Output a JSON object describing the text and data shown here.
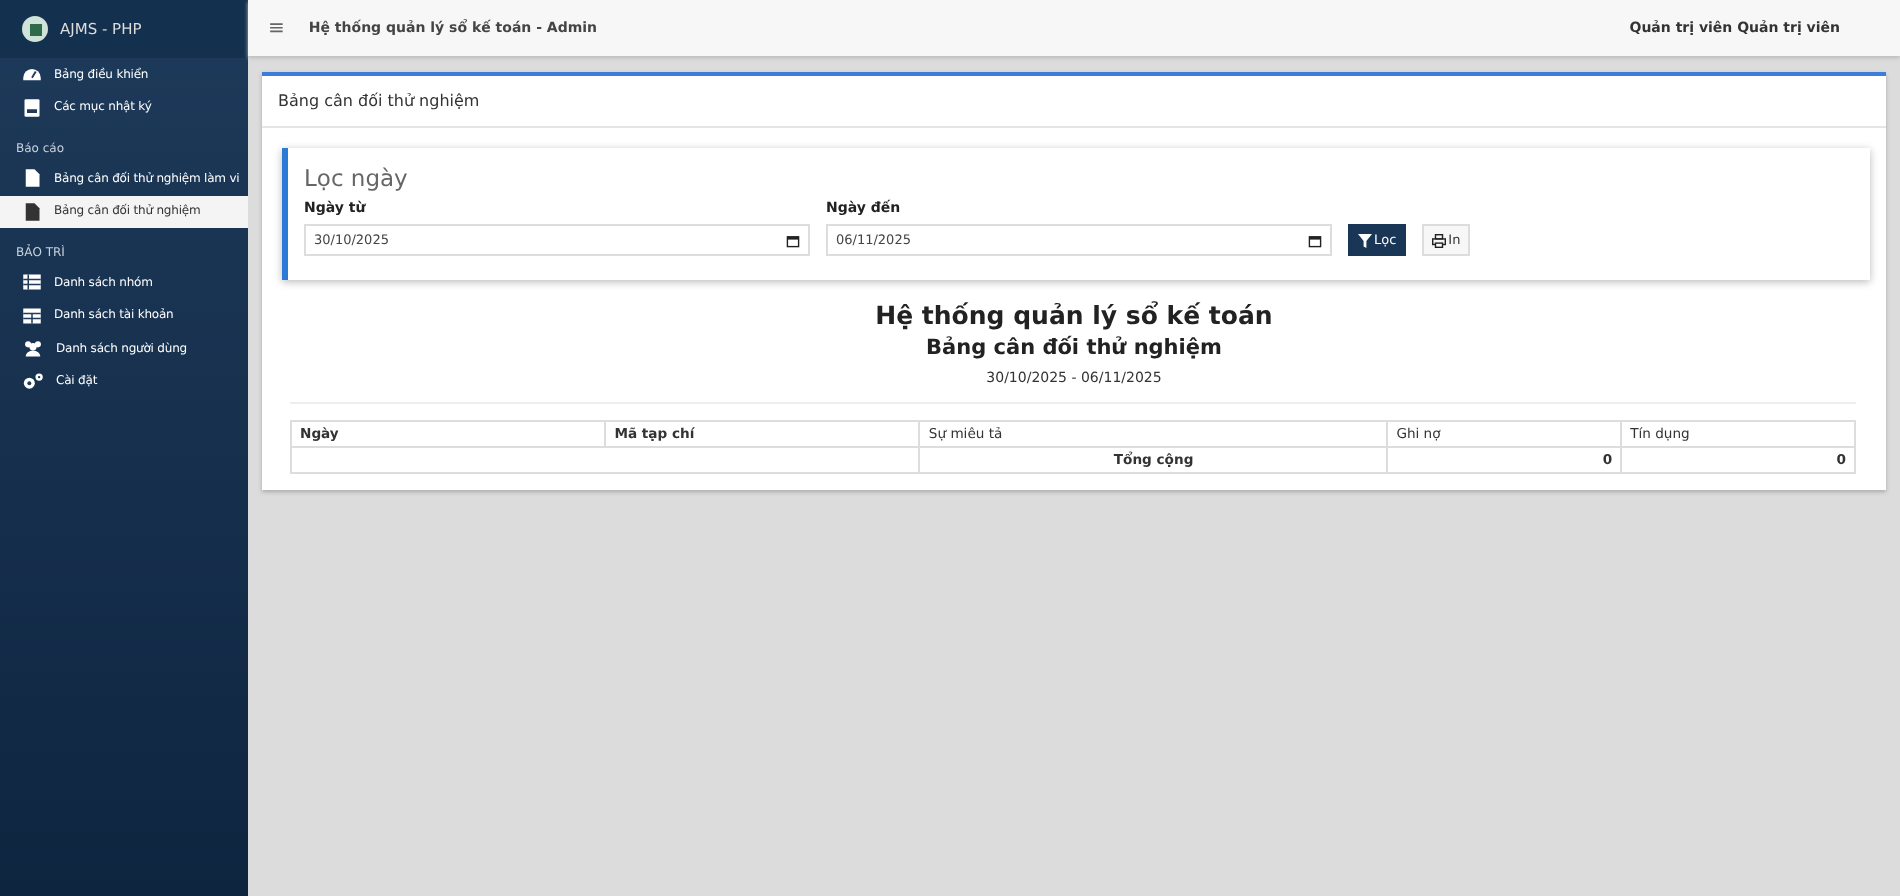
{
  "sidebar": {
    "brand": "AJMS - PHP",
    "items": [
      {
        "kind": "item",
        "label": "Bảng điều khiển",
        "selected": false
      },
      {
        "kind": "item",
        "label": "Các mục nhật ký",
        "selected": false
      },
      {
        "kind": "header",
        "label": "Báo cáo"
      },
      {
        "kind": "item",
        "label": "Bảng cân đối thử nghiệm làm vi",
        "selected": false
      },
      {
        "kind": "item",
        "label": "Bảng cân đối thử nghiệm",
        "selected": true
      },
      {
        "kind": "header",
        "label": "BẢO TRÌ"
      },
      {
        "kind": "item",
        "label": "Danh sách nhóm",
        "selected": false
      },
      {
        "kind": "item",
        "label": "Danh sách tài khoản",
        "selected": false
      },
      {
        "kind": "item",
        "label": "Danh sách người dùng",
        "selected": false
      },
      {
        "kind": "item",
        "label": "Cài đặt",
        "selected": false
      }
    ]
  },
  "topbar": {
    "menu_glyph": "≡",
    "title": "Hệ thống quản lý sổ kế toán - Admin",
    "user": "Quản trị viên Quản trị viên"
  },
  "card": {
    "title": "Bảng cân đối thử nghiệm",
    "filter": {
      "heading": "Lọc ngày",
      "from_label": "Ngày từ",
      "from_value": "30/10/2025",
      "to_label": "Ngày đến",
      "to_value": "06/11/2025",
      "filter_button": "Lọc",
      "print_button": "In"
    },
    "report": {
      "title": "Hệ thống quản lý sổ kế toán",
      "subtitle": "Bảng cân đối thử nghiệm",
      "range": "30/10/2025 - 06/11/2025",
      "columns": [
        "Ngày",
        "Mã tạp chí",
        "Sự miêu tả",
        "Ghi nợ",
        "Tín dụng"
      ],
      "total": {
        "label": "Tổng cộng",
        "debit": "0",
        "credit": "0"
      }
    }
  }
}
